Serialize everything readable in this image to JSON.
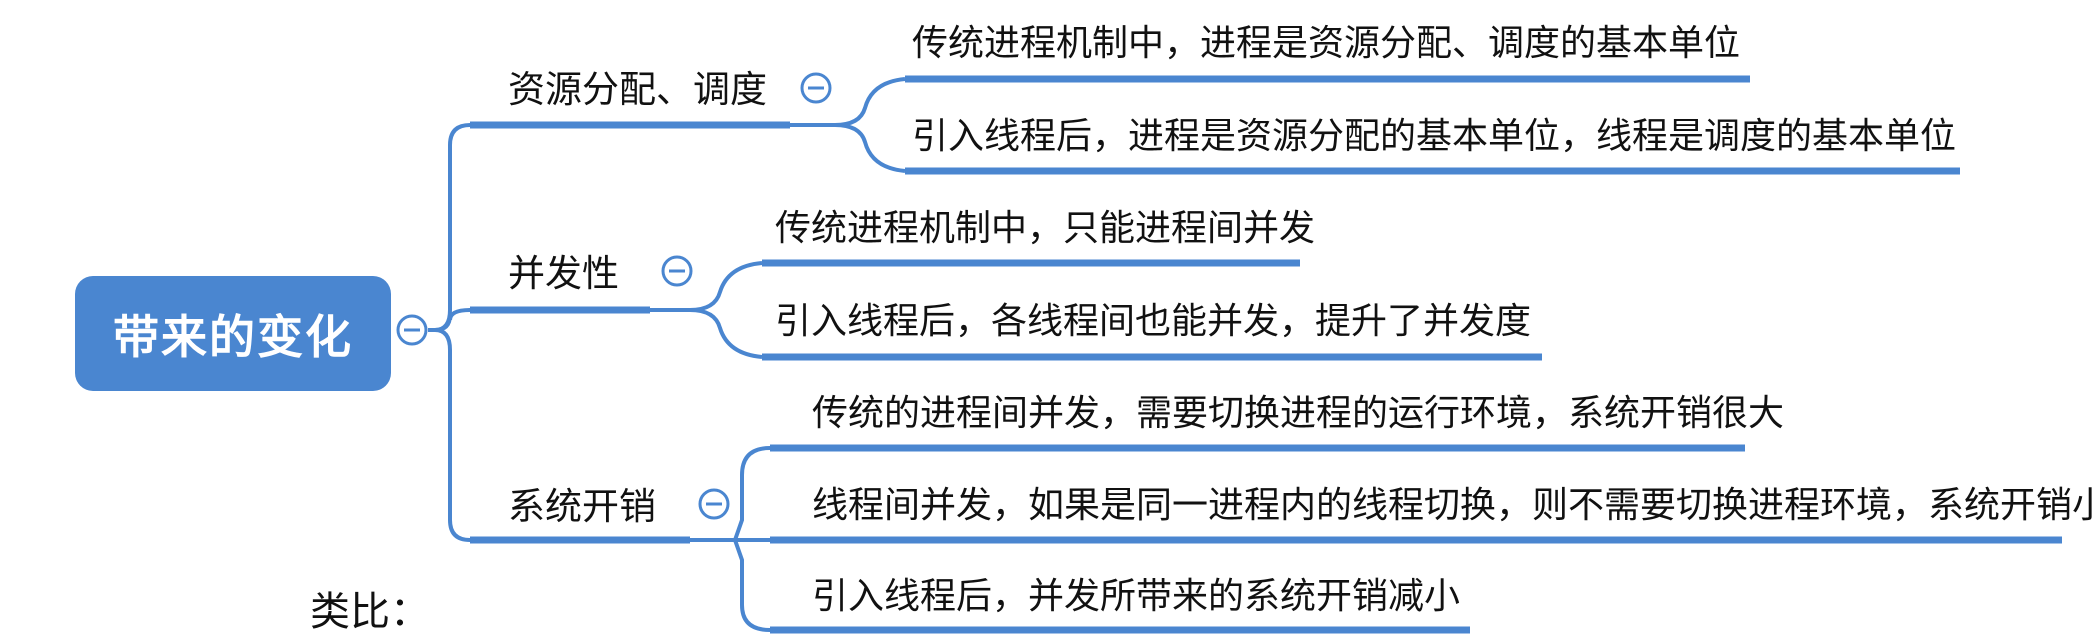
{
  "root": {
    "label": "带来的变化"
  },
  "branches": [
    {
      "label": "资源分配、调度",
      "children": [
        "传统进程机制中，进程是资源分配、调度的基本单位",
        "引入线程后，进程是资源分配的基本单位，线程是调度的基本单位"
      ]
    },
    {
      "label": "并发性",
      "children": [
        "传统进程机制中，只能进程间并发",
        "引入线程后，各线程间也能并发，提升了并发度"
      ]
    },
    {
      "label": "系统开销",
      "children": [
        "传统的进程间并发，需要切换进程的运行环境，系统开销很大",
        "线程间并发，如果是同一进程内的线程切换，则不需要切换进程环境，系统开销小",
        "引入线程后，并发所带来的系统开销减小"
      ]
    }
  ],
  "footer": {
    "text": "类比："
  },
  "colors": {
    "root_fill": "#4a86d0",
    "line": "#4a86d0",
    "toggle": "#4a86d0"
  },
  "icons": {
    "collapse": "collapse-minus-icon"
  }
}
